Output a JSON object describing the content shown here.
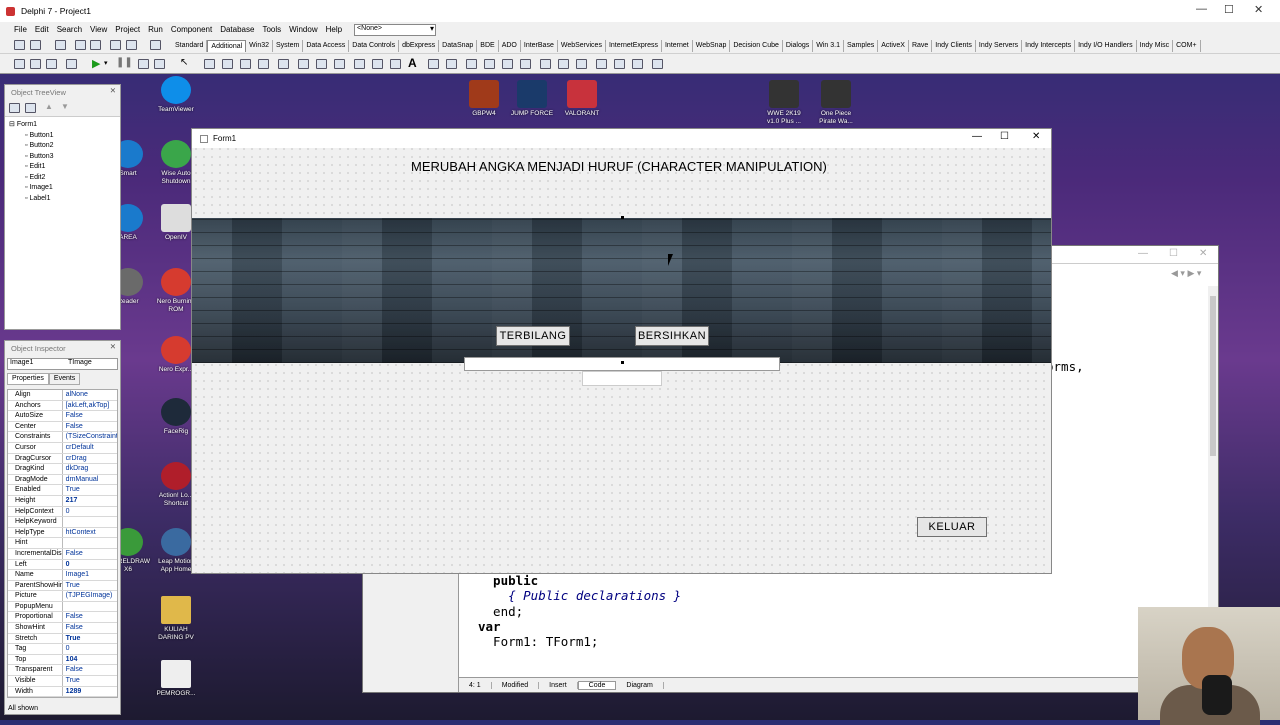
{
  "ide": {
    "title": "Delphi 7 - Project1",
    "menu": [
      "File",
      "Edit",
      "Search",
      "View",
      "Project",
      "Run",
      "Component",
      "Database",
      "Tools",
      "Window",
      "Help"
    ],
    "combo_value": "<None>",
    "palette_tabs": [
      "Standard",
      "Additional",
      "Win32",
      "System",
      "Data Access",
      "Data Controls",
      "dbExpress",
      "DataSnap",
      "BDE",
      "ADO",
      "InterBase",
      "WebServices",
      "InternetExpress",
      "Internet",
      "WebSnap",
      "Decision Cube",
      "Dialogs",
      "Win 3.1",
      "Samples",
      "ActiveX",
      "Rave",
      "Indy Clients",
      "Indy Servers",
      "Indy Intercepts",
      "Indy I/O Handlers",
      "Indy Misc",
      "COM+"
    ],
    "active_palette_tab": "Additional"
  },
  "treeview": {
    "title": "Object TreeView",
    "root": "Form1",
    "items": [
      "Button1",
      "Button2",
      "Button3",
      "Edit1",
      "Edit2",
      "Image1",
      "Label1"
    ]
  },
  "inspector": {
    "title": "Object Inspector",
    "selected_object": "Image1",
    "selected_type": "TImage",
    "tabs": [
      "Properties",
      "Events"
    ],
    "properties": [
      [
        "Align",
        "alNone"
      ],
      [
        "Anchors",
        "[akLeft,akTop]"
      ],
      [
        "AutoSize",
        "False"
      ],
      [
        "Center",
        "False"
      ],
      [
        "Constraints",
        "(TSizeConstraints)"
      ],
      [
        "Cursor",
        "crDefault"
      ],
      [
        "DragCursor",
        "crDrag"
      ],
      [
        "DragKind",
        "dkDrag"
      ],
      [
        "DragMode",
        "dmManual"
      ],
      [
        "Enabled",
        "True"
      ],
      [
        "Height",
        "217"
      ],
      [
        "HelpContext",
        "0"
      ],
      [
        "HelpKeyword",
        ""
      ],
      [
        "HelpType",
        "htContext"
      ],
      [
        "Hint",
        ""
      ],
      [
        "IncrementalDisplay",
        "False"
      ],
      [
        "Left",
        "0"
      ],
      [
        "Name",
        "Image1"
      ],
      [
        "ParentShowHint",
        "True"
      ],
      [
        "Picture",
        "(TJPEGImage)"
      ],
      [
        "PopupMenu",
        ""
      ],
      [
        "Proportional",
        "False"
      ],
      [
        "ShowHint",
        "False"
      ],
      [
        "Stretch",
        "True"
      ],
      [
        "Tag",
        "0"
      ],
      [
        "Top",
        "104"
      ],
      [
        "Transparent",
        "False"
      ],
      [
        "Visible",
        "True"
      ],
      [
        "Width",
        "1289"
      ]
    ],
    "status": "All shown"
  },
  "desktop_icons": {
    "top": [
      "GBPW4",
      "JUMP FORCE",
      "VALORANT",
      "WWE 2K19 v1.0 Plus ...",
      "One Piece Pirate Wa..."
    ],
    "left": [
      "TeamViewer",
      "Smart",
      "Wise Auto Shutdown",
      "AREA",
      "OpenIV",
      "Reader",
      "Nero Burning ROM",
      "Nero Expr...",
      "FaceRig",
      "Action! Lo... Shortcut",
      "CORELDRAW X6",
      "Leap Motion App Home",
      "KULIAH DARING PV",
      "PEMROGR..."
    ]
  },
  "form": {
    "title": "Form1",
    "label": "MERUBAH ANGKA MENJADI HURUF (CHARACTER MANIPULATION)",
    "btn_terbilang": "TERBILANG",
    "btn_bersihkan": "BERSIHKAN",
    "btn_keluar": "KELUAR",
    "edit1_value": "",
    "edit2_value": ""
  },
  "editor": {
    "code_forms": "orms,",
    "status_pos": "4:  1",
    "status_modified": "Modified",
    "status_insert": "Insert",
    "tab_code": "Code",
    "tab_diagram": "Diagram",
    "lines": [
      "  public",
      "    { Public declarations }",
      "  end;",
      "",
      "var",
      "  Form1: TForm1;"
    ]
  }
}
